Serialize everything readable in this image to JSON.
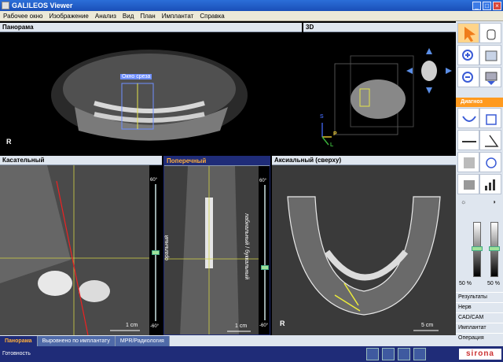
{
  "window": {
    "title": "GALILEOS Viewer"
  },
  "menu": [
    "Рабочее окно",
    "Изображение",
    "Анализ",
    "Вид",
    "План",
    "Имплантат",
    "Справка"
  ],
  "panels": {
    "panorama": {
      "title": "Панорама",
      "orient": "R",
      "slice_window_label": "Окно среза"
    },
    "view3d": {
      "title": "3D",
      "axis_s": "S",
      "axis_p": "P",
      "axis_l": "L"
    },
    "tangential": {
      "title": "Касательный",
      "scale": "1 cm",
      "slider_top": "60°",
      "slider_bottom": "-60°"
    },
    "transversal": {
      "title": "Поперечный",
      "label_oral": "оральный",
      "label_buccal": "лабиальный / буккальный",
      "scale": "1 cm",
      "slider_top": "60°",
      "slider_bottom": "-60°"
    },
    "axial": {
      "title": "Аксиальный (сверху)",
      "orient": "R",
      "scale": "5 cm"
    }
  },
  "tabs": [
    {
      "label": "Панорама",
      "active": true
    },
    {
      "label": "Выровнено по имплантату",
      "active": false
    },
    {
      "label": "MPR/Радиология",
      "active": false
    }
  ],
  "toolpanel": {
    "diagnosis_section": "Диагноз",
    "brightness_value": "50 %",
    "contrast_value": "50 %",
    "list": [
      "Результаты",
      "Нерв",
      "CAD/CAM",
      "Имплантат",
      "Операция"
    ]
  },
  "status": {
    "text": "Готовность",
    "brand": "sirona"
  },
  "colors": {
    "header_active": "#1f2c78",
    "accent_orange": "#ffae3b",
    "section_orange": "#ff9a1f"
  }
}
